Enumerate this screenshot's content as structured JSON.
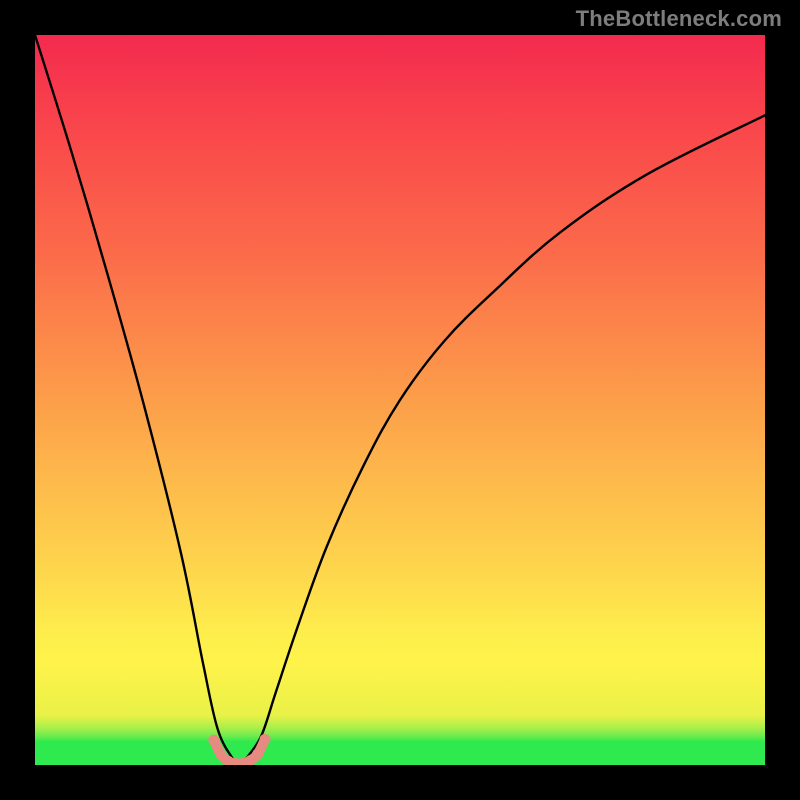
{
  "watermark": "TheBottleneck.com",
  "chart_data": {
    "type": "line",
    "title": "",
    "xlabel": "",
    "ylabel": "",
    "xlim": [
      0,
      100
    ],
    "ylim": [
      0,
      100
    ],
    "grid": false,
    "background_gradient": {
      "top": "#f32a4e",
      "mid_upper": "#fb6b4a",
      "mid": "#fee14c",
      "mid_lower": "#fff34a",
      "bottom": "#2fea4f",
      "description": "vertical red-to-green gradient, green at bottom"
    },
    "series": [
      {
        "name": "bottleneck-curve",
        "description": "V-shaped dip; minimum near x≈28, y≈0; rises steeply left, shallower on right",
        "color": "#000000",
        "x": [
          0,
          5,
          10,
          15,
          20,
          23,
          25,
          27,
          28,
          29,
          31,
          33,
          36,
          40,
          45,
          50,
          56,
          63,
          72,
          84,
          100
        ],
        "y": [
          100,
          84,
          67,
          49,
          29,
          14,
          5,
          1,
          0,
          1,
          4,
          10,
          19,
          30,
          41,
          50,
          58,
          65,
          73,
          81,
          89
        ]
      },
      {
        "name": "trough-marker",
        "description": "short salmon U-shaped highlight at the curve minimum",
        "color": "#e78b81",
        "x": [
          24.5,
          25.5,
          26.5,
          27.5,
          28.5,
          29.5,
          30.5,
          31.5
        ],
        "y": [
          3.4,
          1.4,
          0.5,
          0.2,
          0.2,
          0.6,
          1.5,
          3.5
        ]
      }
    ]
  }
}
